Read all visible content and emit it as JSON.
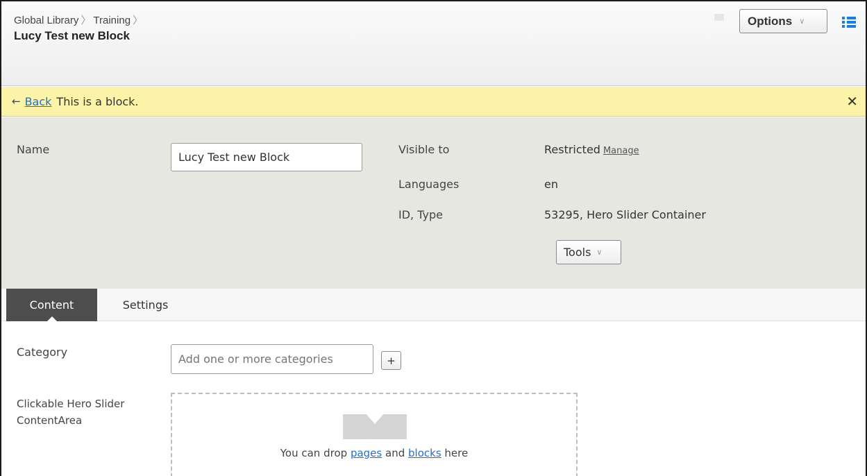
{
  "header": {
    "breadcrumb": [
      "Global Library",
      "Training"
    ],
    "title": "Lucy Test new Block",
    "options_label": "Options"
  },
  "notice": {
    "back_label": "Back",
    "message": "This is a block."
  },
  "properties": {
    "name_label": "Name",
    "name_value": "Lucy Test new Block",
    "visible_to_label": "Visible to",
    "visible_to_value": "Restricted",
    "manage_label": "Manage",
    "languages_label": "Languages",
    "languages_value": "en",
    "id_type_label": "ID, Type",
    "id_type_value": "53295, Hero Slider Container",
    "tools_label": "Tools"
  },
  "tabs": [
    {
      "label": "Content",
      "active": true
    },
    {
      "label": "Settings",
      "active": false
    }
  ],
  "content": {
    "category_label": "Category",
    "category_placeholder": "Add one or more categories",
    "add_label": "+",
    "content_area_label_line1": "Clickable Hero Slider",
    "content_area_label_line2": "ContentArea",
    "drop_text_prefix": "You can drop",
    "drop_link_pages": "pages",
    "drop_text_and": "and",
    "drop_link_blocks": "blocks",
    "drop_text_suffix": "here"
  },
  "colors": {
    "accent": "#1e7fd9",
    "notice_bg": "#fbf3a8",
    "panel_bg": "#e7e7e1",
    "active_tab": "#4d4d4d"
  }
}
